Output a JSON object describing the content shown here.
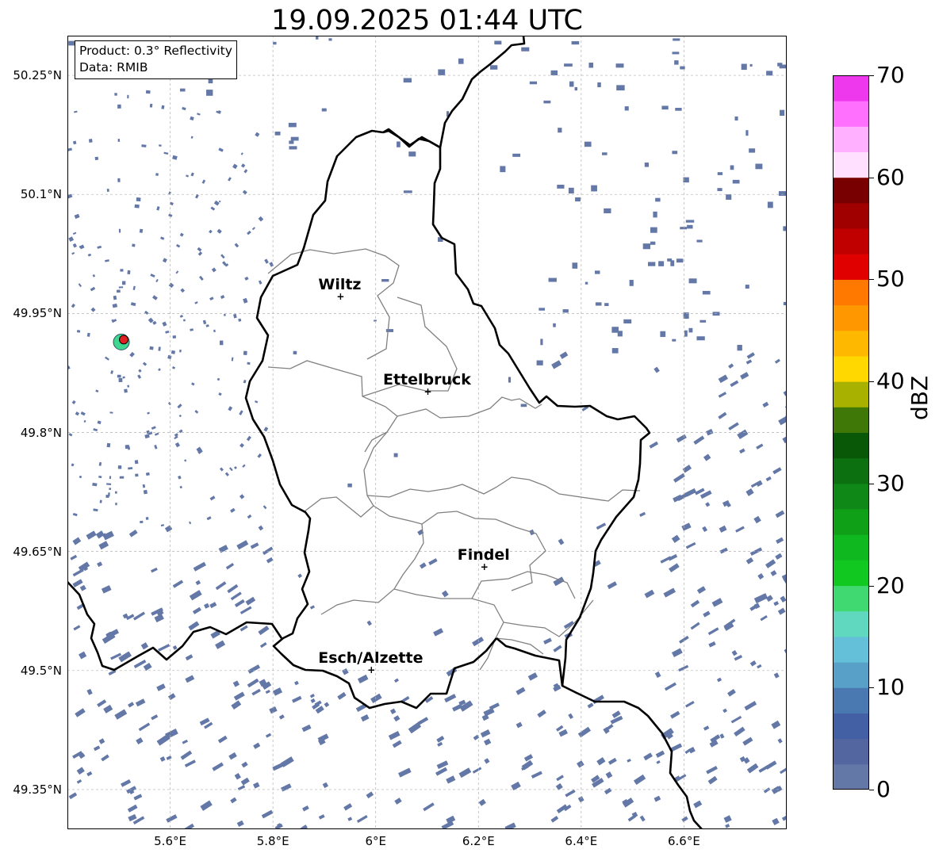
{
  "title": "19.09.2025 01:44 UTC",
  "info_box": {
    "product": "Product: 0.3° Reflectivity",
    "data": "Data: RMIB"
  },
  "map": {
    "lon_range": [
      5.4,
      6.8
    ],
    "lat_range": [
      49.3,
      50.3
    ],
    "lat_ticks": [
      {
        "value": 50.25,
        "label": "50.25°N"
      },
      {
        "value": 50.1,
        "label": "50.1°N"
      },
      {
        "value": 49.95,
        "label": "49.95°N"
      },
      {
        "value": 49.8,
        "label": "49.8°N"
      },
      {
        "value": 49.65,
        "label": "49.65°N"
      },
      {
        "value": 49.5,
        "label": "49.5°N"
      },
      {
        "value": 49.35,
        "label": "49.35°N"
      }
    ],
    "lon_ticks": [
      {
        "value": 5.6,
        "label": "5.6°E"
      },
      {
        "value": 5.8,
        "label": "5.8°E"
      },
      {
        "value": 6.0,
        "label": "6°E"
      },
      {
        "value": 6.2,
        "label": "6.2°E"
      },
      {
        "value": 6.4,
        "label": "6.4°E"
      },
      {
        "value": 6.6,
        "label": "6.6°E"
      }
    ],
    "cities": [
      {
        "name": "Wiltz",
        "lon": 5.93,
        "lat": 49.97
      },
      {
        "name": "Ettelbruck",
        "lon": 6.1,
        "lat": 49.85
      },
      {
        "name": "Findel",
        "lon": 6.21,
        "lat": 49.63
      },
      {
        "name": "Esch/Alzette",
        "lon": 5.99,
        "lat": 49.5
      }
    ],
    "radar_site": {
      "lon": 5.505,
      "lat": 49.914
    },
    "colors": {
      "echo": "#6478a8",
      "border": "#000000",
      "district": "#808080",
      "grid": "#b0b0b0",
      "radar_marker": "#e02020"
    }
  },
  "colorbar": {
    "label": "dBZ",
    "min": 0,
    "max": 70,
    "ticks": [
      {
        "value": 0,
        "label": "0"
      },
      {
        "value": 10,
        "label": "10"
      },
      {
        "value": 20,
        "label": "20"
      },
      {
        "value": 30,
        "label": "30"
      },
      {
        "value": 40,
        "label": "40"
      },
      {
        "value": 50,
        "label": "50"
      },
      {
        "value": 60,
        "label": "60"
      },
      {
        "value": 70,
        "label": "70"
      }
    ],
    "colors": [
      "#6478a8",
      "#5466a0",
      "#4460a4",
      "#4a78b0",
      "#58a0c8",
      "#64c0d8",
      "#60d8c0",
      "#40d870",
      "#10c820",
      "#10b820",
      "#10a018",
      "#108818",
      "#0c7010",
      "#085808",
      "#407808",
      "#a8b000",
      "#ffd800",
      "#ffb800",
      "#ff9800",
      "#ff7800",
      "#e00000",
      "#c00000",
      "#a00000",
      "#780000",
      "#ffe0ff",
      "#ffb0ff",
      "#ff70ff",
      "#ee38ee"
    ]
  }
}
